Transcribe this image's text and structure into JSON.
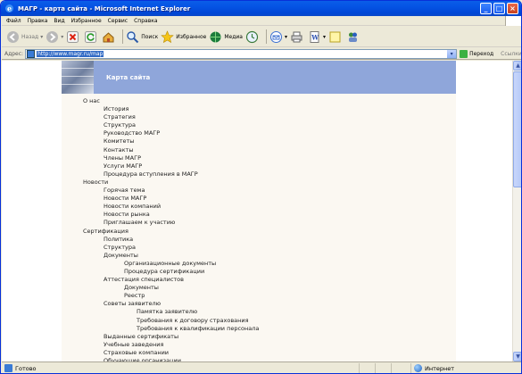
{
  "window": {
    "title": "МАГР - карта сайта - Microsoft Internet Explorer",
    "controls": {
      "minimize": "_",
      "maximize": "□",
      "close": "×"
    }
  },
  "menu": [
    "Файл",
    "Правка",
    "Вид",
    "Избранное",
    "Сервис",
    "Справка"
  ],
  "toolbar": {
    "back": "Назад",
    "search": "Поиск",
    "favorites": "Избранное",
    "media": "Медиа"
  },
  "address": {
    "label": "Адрес:",
    "url": "http://www.magr.ru/map",
    "go": "Переход",
    "links": "Ссылки"
  },
  "page": {
    "title": "Карта сайта",
    "sitemap": [
      {
        "label": "О нас",
        "level": 0
      },
      {
        "label": "История",
        "level": 1
      },
      {
        "label": "Стратегия",
        "level": 1
      },
      {
        "label": "Структура",
        "level": 1
      },
      {
        "label": "Руководство МАГР",
        "level": 1
      },
      {
        "label": "Комитеты",
        "level": 1
      },
      {
        "label": "Контакты",
        "level": 1
      },
      {
        "label": "Члены МАГР",
        "level": 1
      },
      {
        "label": "Услуги МАГР",
        "level": 1
      },
      {
        "label": "Процедура вступления в МАГР",
        "level": 1
      },
      {
        "label": "Новости",
        "level": 0
      },
      {
        "label": "Горячая тема",
        "level": 1
      },
      {
        "label": "Новости МАГР",
        "level": 1
      },
      {
        "label": "Новости компаний",
        "level": 1
      },
      {
        "label": "Новости рынка",
        "level": 1
      },
      {
        "label": "Приглашаем к участию",
        "level": 1
      },
      {
        "label": "Сертификация",
        "level": 0
      },
      {
        "label": "Политика",
        "level": 1
      },
      {
        "label": "Структура",
        "level": 1
      },
      {
        "label": "Документы",
        "level": 1
      },
      {
        "label": "Организационные документы",
        "level": 2
      },
      {
        "label": "Процедура сертификации",
        "level": 2
      },
      {
        "label": "Аттестация специалистов",
        "level": 1
      },
      {
        "label": "Документы",
        "level": 2
      },
      {
        "label": "Реестр",
        "level": 2
      },
      {
        "label": "Советы заявителю",
        "level": 1
      },
      {
        "label": "Памятка заявителю",
        "level": 3
      },
      {
        "label": "Требования к договору страхования",
        "level": 3
      },
      {
        "label": "Требования к квалификации персонала",
        "level": 3
      },
      {
        "label": "Выданные сертификаты",
        "level": 1
      },
      {
        "label": "Учебные заведения",
        "level": 1
      },
      {
        "label": "Страховые компании",
        "level": 1
      },
      {
        "label": "Обучающие организации",
        "level": 1
      }
    ]
  },
  "status": {
    "text": "Готово",
    "zone": "Интернет"
  }
}
